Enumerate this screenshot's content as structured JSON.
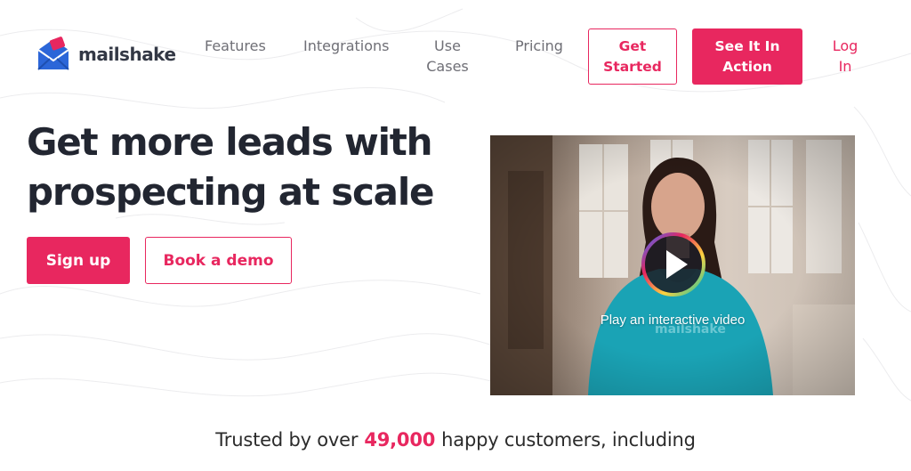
{
  "brand": {
    "name": "mailshake",
    "accent_color": "#e8275f",
    "logo_color": "#2c66d8"
  },
  "nav": {
    "features": "Features",
    "integrations": "Integrations",
    "use_cases_line1": "Use",
    "use_cases_line2": "Cases",
    "pricing": "Pricing",
    "get_started_line1": "Get",
    "get_started_line2": "Started",
    "see_it_line1": "See It In",
    "see_it_line2": "Action",
    "login_line1": "Log",
    "login_line2": "In"
  },
  "hero": {
    "headline_line1": "Get more leads with",
    "headline_line2": "prospecting at scale",
    "signup_label": "Sign up",
    "demo_label": "Book a demo"
  },
  "video": {
    "caption": "Play an interactive video",
    "shirt_text": "mailshake",
    "play_icon": "play-icon"
  },
  "trust": {
    "prefix": "Trusted by over",
    "count": "49,000",
    "suffix": "happy customers, including"
  }
}
